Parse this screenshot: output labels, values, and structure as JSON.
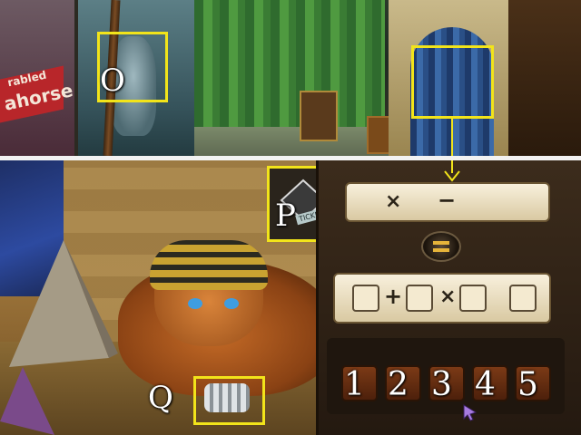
{
  "scene_top": {
    "poster_lines": [
      "rabled",
      "ahorse"
    ]
  },
  "hotspots": {
    "o_label": "O",
    "p_label": "P",
    "q_label": "Q"
  },
  "ticket_label": "TICKET",
  "puzzle": {
    "result_ops": [
      "×",
      "−"
    ],
    "equation_ops": [
      "+",
      "×"
    ],
    "numbers": [
      "1",
      "2",
      "3",
      "4",
      "5"
    ]
  },
  "colors": {
    "highlight": "#f2e41a",
    "panel": "#f4ead0",
    "tile": "#6a2f12"
  }
}
